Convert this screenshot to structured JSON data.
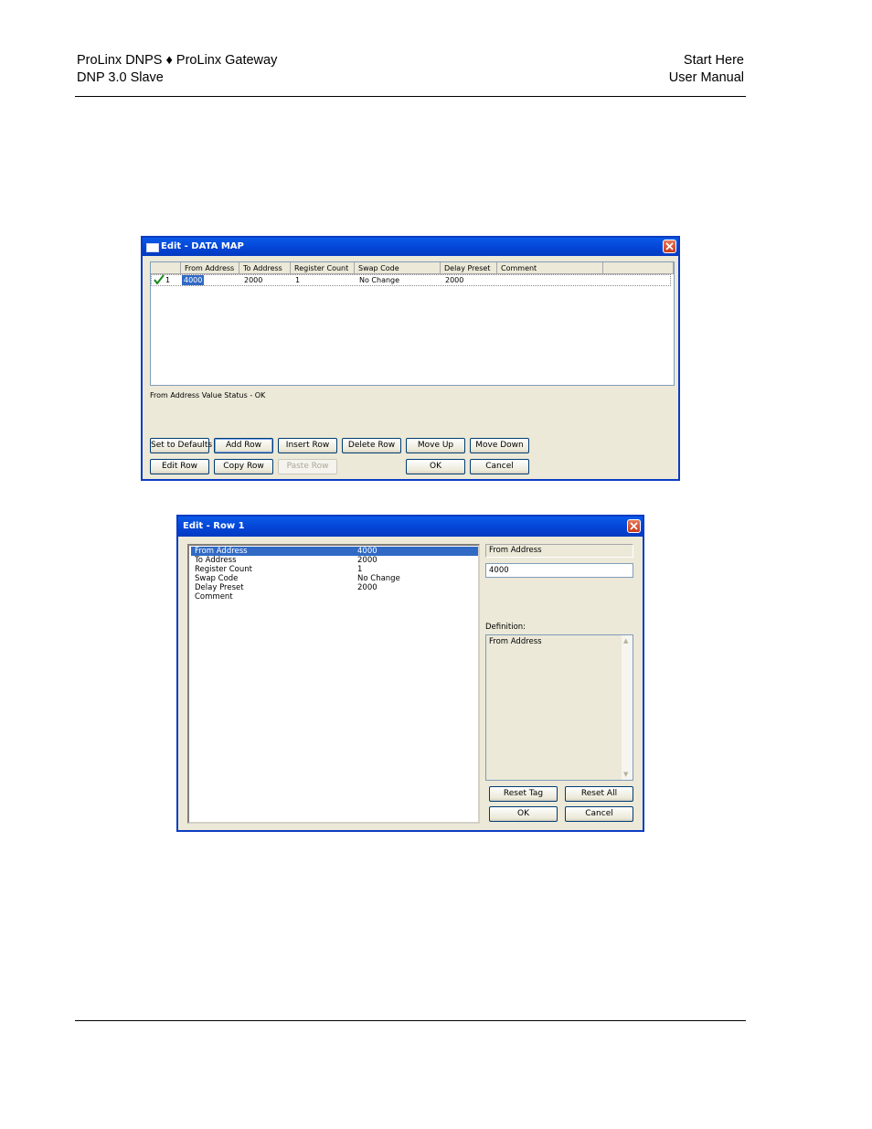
{
  "header": {
    "left_line1": "ProLinx DNPS ♦ ProLinx Gateway",
    "left_line2": "DNP 3.0 Slave",
    "right_line1": "Start Here",
    "right_line2": "User Manual"
  },
  "data_map_window": {
    "title": "Edit - DATA MAP",
    "columns": [
      "From Address",
      "To Address",
      "Register Count",
      "Swap Code",
      "Delay Preset",
      "Comment"
    ],
    "rows": [
      {
        "index": "1",
        "from_address": "4000",
        "to_address": "2000",
        "register_count": "1",
        "swap_code": "No Change",
        "delay_preset": "2000",
        "comment": ""
      }
    ],
    "status": "From Address Value Status - OK",
    "buttons": {
      "set_defaults": "Set to Defaults",
      "add_row": "Add Row",
      "insert_row": "Insert Row",
      "delete_row": "Delete Row",
      "move_up": "Move Up",
      "move_down": "Move Down",
      "edit_row": "Edit Row",
      "copy_row": "Copy Row",
      "paste_row": "Paste Row",
      "ok": "OK",
      "cancel": "Cancel"
    },
    "check_icon": "checkmark-icon"
  },
  "edit_row_window": {
    "title": "Edit - Row 1",
    "items": [
      {
        "name": "From Address",
        "value": "4000"
      },
      {
        "name": "To Address",
        "value": "2000"
      },
      {
        "name": "Register Count",
        "value": "1"
      },
      {
        "name": "Swap Code",
        "value": "No Change"
      },
      {
        "name": "Delay Preset",
        "value": "2000"
      },
      {
        "name": "Comment",
        "value": ""
      }
    ],
    "selected_field": "From Address",
    "field_value": "4000",
    "definition_label": "Definition:",
    "definition_text": "From Address",
    "buttons": {
      "reset_tag": "Reset Tag",
      "reset_all": "Reset All",
      "ok": "OK",
      "cancel": "Cancel"
    }
  },
  "colors": {
    "title_bar": "#0445d6",
    "selection": "#316ac5",
    "dialog_bg": "#ece9d8"
  }
}
